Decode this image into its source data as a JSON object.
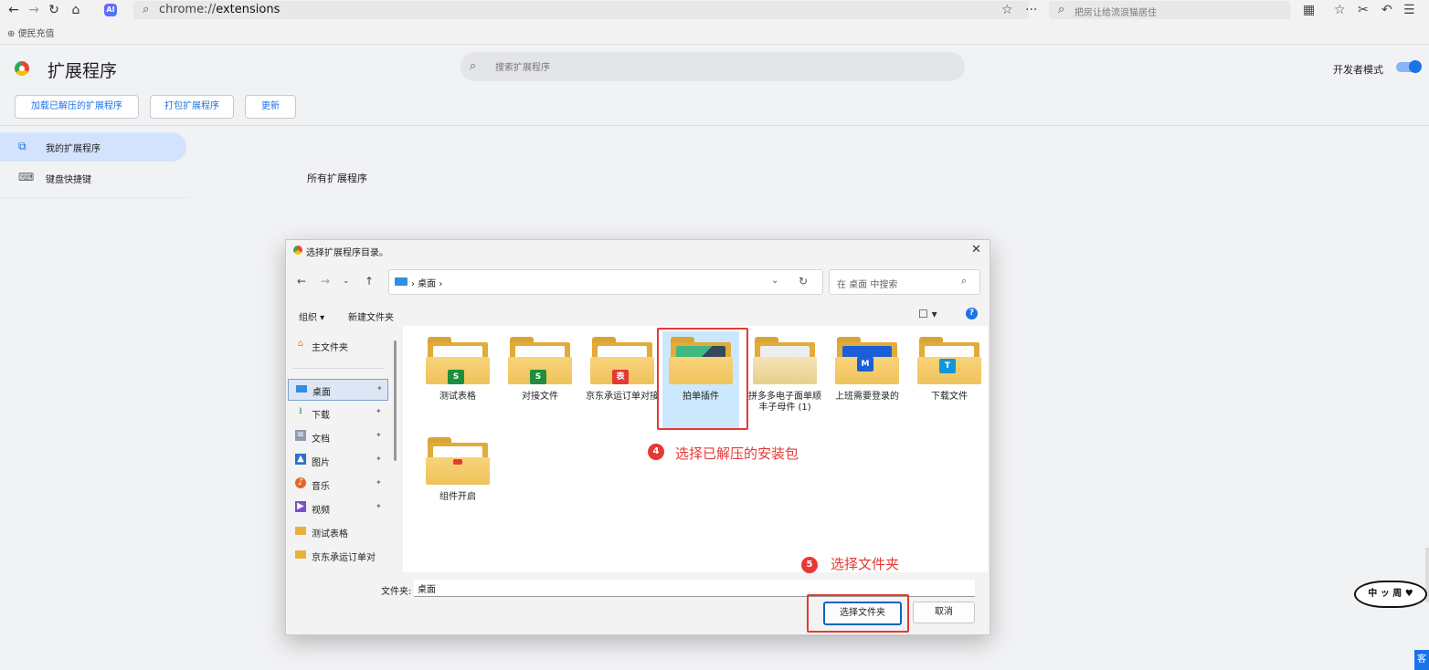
{
  "browser": {
    "ai_badge": "AI",
    "url_scheme": "chrome://",
    "url_path": "extensions",
    "search_placeholder": "把房让给流浪猫居住",
    "bookmark": "便民充值"
  },
  "extensions": {
    "title": "扩展程序",
    "search_placeholder": "搜索扩展程序",
    "dev_mode_label": "开发者模式",
    "buttons": [
      "加载已解压的扩展程序",
      "打包扩展程序",
      "更新"
    ],
    "sidebar": [
      "我的扩展程序",
      "键盘快捷键"
    ],
    "all_extensions": "所有扩展程序"
  },
  "dialog": {
    "title": "选择扩展程序目录。",
    "breadcrumb": "›  桌面  ›",
    "search_placeholder": "在 桌面 中搜索",
    "organize": "组织 ▾",
    "new_folder": "新建文件夹",
    "nav": {
      "home": "主文件夹",
      "items": [
        {
          "label": "桌面",
          "icon": "desktop-icon",
          "pinned": true
        },
        {
          "label": "下载",
          "icon": "download-icon",
          "pinned": true
        },
        {
          "label": "文档",
          "icon": "document-icon",
          "pinned": true
        },
        {
          "label": "图片",
          "icon": "picture-icon",
          "pinned": true
        },
        {
          "label": "音乐",
          "icon": "music-icon",
          "pinned": true
        },
        {
          "label": "视频",
          "icon": "video-icon",
          "pinned": true
        },
        {
          "label": "测试表格",
          "icon": "folder-icon",
          "pinned": false
        },
        {
          "label": "京东承运订单对",
          "icon": "folder-icon",
          "pinned": false
        }
      ]
    },
    "folders": [
      {
        "label": "测试表格",
        "emblem": "S",
        "emblem_color": "#1e8e3e"
      },
      {
        "label": "对接文件",
        "emblem": "S",
        "emblem_color": "#1e8e3e"
      },
      {
        "label": "京东承运订单对接",
        "emblem": "表",
        "emblem_color": "#e53935"
      },
      {
        "label": "拍单插件",
        "emblem": "V",
        "emblem_color": "#41b883"
      },
      {
        "label": "拼多多电子面单顺丰子母件 (1)",
        "emblem": "",
        "emblem_color": "#cccccc"
      },
      {
        "label": "上班需要登录的",
        "emblem": "M",
        "emblem_color": "#1a5fd6"
      },
      {
        "label": "下载文件",
        "emblem": "T",
        "emblem_color": "#1296db"
      },
      {
        "label": "组件开启",
        "emblem": "",
        "emblem_color": "#e53935"
      }
    ],
    "annotation_4": {
      "num": "4",
      "text": "选择已解压的安装包"
    },
    "annotation_5": {
      "num": "5",
      "text": "选择文件夹"
    },
    "folder_label": "文件夹:",
    "folder_value": "桌面",
    "select_button": "选择文件夹",
    "cancel_button": "取消"
  },
  "stamp_text": "中 ッ 周 ♥",
  "corner_badge": "客"
}
